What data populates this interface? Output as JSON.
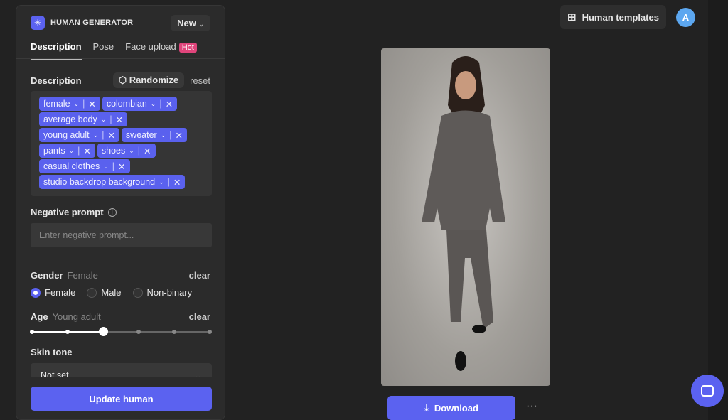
{
  "app": {
    "title": "HUMAN GENERATOR",
    "new_label": "New"
  },
  "tabs": [
    {
      "label": "Description"
    },
    {
      "label": "Pose"
    },
    {
      "label": "Face upload",
      "badge": "Hot"
    }
  ],
  "description": {
    "label": "Description",
    "randomize": "Randomize",
    "reset": "reset",
    "tags": [
      "female",
      "colombian",
      "average body",
      "young adult",
      "sweater",
      "pants",
      "shoes",
      "casual clothes",
      "studio backdrop background"
    ]
  },
  "negative": {
    "label": "Negative prompt",
    "placeholder": "Enter negative prompt..."
  },
  "gender": {
    "label": "Gender",
    "value": "Female",
    "clear": "clear",
    "options": [
      "Female",
      "Male",
      "Non-binary"
    ],
    "selected": 0
  },
  "age": {
    "label": "Age",
    "value": "Young adult",
    "clear": "clear",
    "steps": 6,
    "selected_index": 2
  },
  "skin": {
    "label": "Skin tone",
    "value": "Not set"
  },
  "update_label": "Update human",
  "top": {
    "templates": "Human templates",
    "avatar": "A"
  },
  "download_label": "Download",
  "more_label": "···",
  "colors": {
    "accent": "#5b62f0",
    "hot": "#e0457b"
  }
}
